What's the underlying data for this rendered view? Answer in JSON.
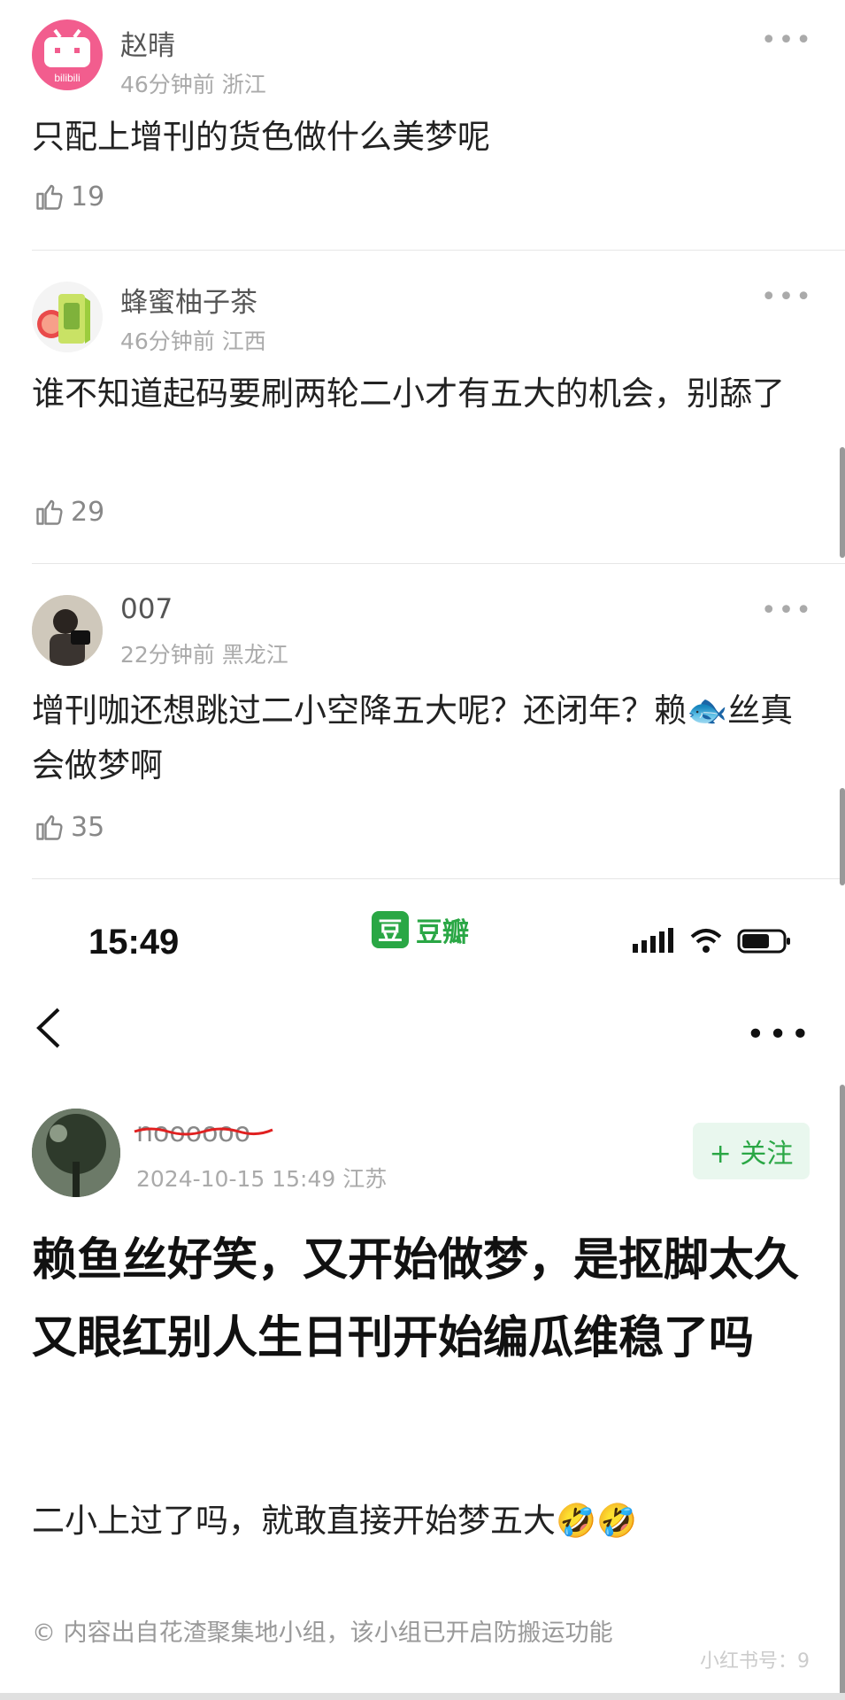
{
  "comments": [
    {
      "user": "赵晴",
      "time": "46分钟前",
      "location": "浙江",
      "text": "只配上增刊的货色做什么美梦呢",
      "likes": "19",
      "more": "•••"
    },
    {
      "user": "蜂蜜柚子茶",
      "time": "46分钟前",
      "location": "江西",
      "text": "谁不知道起码要刷两轮二小才有五大的机会，别舔了",
      "likes": "29",
      "more": "•••"
    },
    {
      "user": "007",
      "time": "22分钟前",
      "location": "黑龙江",
      "text": "增刊咖还想跳过二小空降五大呢？还闭年？赖🐟丝真会做梦啊",
      "likes": "35",
      "more": "•••"
    }
  ],
  "status_bar": {
    "time": "15:49",
    "app_logo_char": "豆",
    "app_name": "豆瓣"
  },
  "nav": {
    "more": "•••"
  },
  "post": {
    "author": "noooooo",
    "date": "2024-10-15 15:49",
    "location": "江苏",
    "follow_label": "+ 关注",
    "title": "赖鱼丝好笑，又开始做梦，是抠脚太久又眼红别人生日刊开始编瓜维稳了吗",
    "body": "二小上过了吗，就敢直接开始梦五大🤣🤣",
    "footer": "© 内容出自花渣聚集地小组，该小组已开启防搬运功能",
    "watermark": "小红书号：9"
  },
  "colors": {
    "accent": "#2aa745",
    "bili_pink": "#f25d8e"
  }
}
